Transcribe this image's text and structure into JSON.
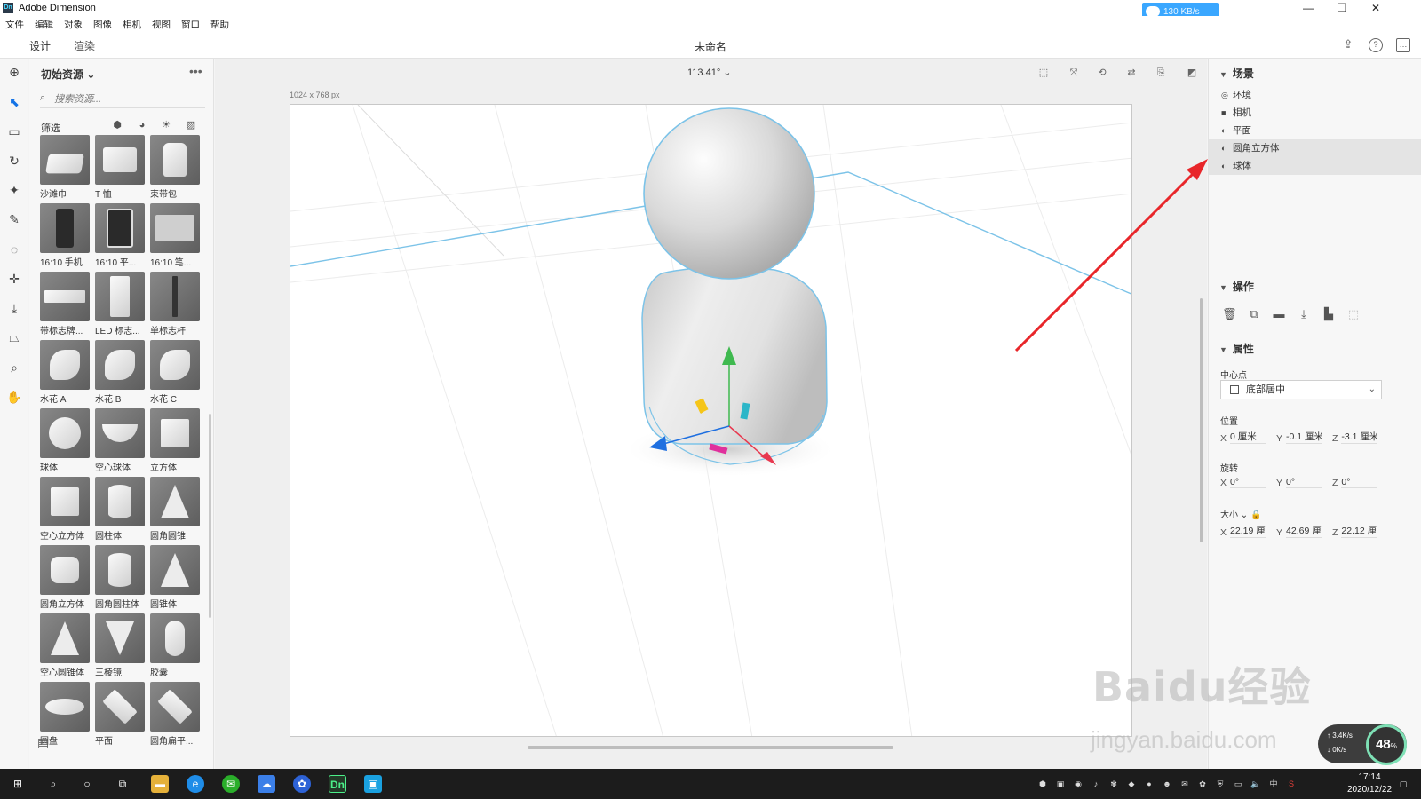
{
  "window": {
    "title": "Adobe Dimension",
    "logo_text": "Dn",
    "net_speed": "130 KB/s",
    "controls": [
      "—",
      "❐",
      "✕"
    ]
  },
  "menu": [
    "文件",
    "编辑",
    "对象",
    "图像",
    "相机",
    "视图",
    "窗口",
    "帮助"
  ],
  "header": {
    "tabs": [
      "设计",
      "渲染"
    ],
    "doc_title": "未命名"
  },
  "assets": {
    "title": "初始资源",
    "title_chevron": "⌄",
    "more": "•••",
    "search_placeholder": "搜索资源...",
    "filter_label": "筛选",
    "items": [
      {
        "label": "沙滩巾",
        "shape": "cloth"
      },
      {
        "label": "T 恤",
        "shape": "shirt"
      },
      {
        "label": "束带包",
        "shape": "bag"
      },
      {
        "label": "16:10 手机",
        "shape": "phone"
      },
      {
        "label": "16:10 平...",
        "shape": "tablet"
      },
      {
        "label": "16:10 笔...",
        "shape": "laptop"
      },
      {
        "label": "带标志牌...",
        "shape": "bench"
      },
      {
        "label": "LED 标志...",
        "shape": "sign"
      },
      {
        "label": "单标志杆",
        "shape": "pole"
      },
      {
        "label": "水花 A",
        "shape": "splash"
      },
      {
        "label": "水花 B",
        "shape": "splash"
      },
      {
        "label": "水花 C",
        "shape": "splash"
      },
      {
        "label": "球体",
        "shape": "sphere"
      },
      {
        "label": "空心球体",
        "shape": "bowl"
      },
      {
        "label": "立方体",
        "shape": "cube"
      },
      {
        "label": "空心立方体",
        "shape": "cube"
      },
      {
        "label": "圆柱体",
        "shape": "cylinder"
      },
      {
        "label": "圆角圆锥",
        "shape": "cone"
      },
      {
        "label": "圆角立方体",
        "shape": "roundcube"
      },
      {
        "label": "圆角圆柱体",
        "shape": "cylinder"
      },
      {
        "label": "圆锥体",
        "shape": "cone"
      },
      {
        "label": "空心圆锥体",
        "shape": "cone"
      },
      {
        "label": "三棱镜",
        "shape": "prism"
      },
      {
        "label": "胶囊",
        "shape": "capsule"
      },
      {
        "label": "圆盘",
        "shape": "disc"
      },
      {
        "label": "平面",
        "shape": "plane"
      },
      {
        "label": "圆角扁平...",
        "shape": "plane"
      }
    ]
  },
  "canvas": {
    "zoom": "113.41°",
    "size_label": "1024 x 768 px"
  },
  "scene": {
    "title": "场景",
    "items": [
      {
        "label": "环境",
        "icon": "◎",
        "selected": false
      },
      {
        "label": "相机",
        "icon": "■",
        "selected": false
      },
      {
        "label": "平面",
        "icon": "◐",
        "selected": false
      },
      {
        "label": "圆角立方体",
        "icon": "◐",
        "selected": true
      },
      {
        "label": "球体",
        "icon": "◐",
        "selected": true
      }
    ]
  },
  "actions": {
    "title": "操作"
  },
  "properties": {
    "title": "属性",
    "pivot_label": "中心点",
    "pivot_value": "底部居中",
    "position_label": "位置",
    "position": {
      "x": "0 厘米",
      "y": "-0.1 厘米",
      "z": "-3.1 厘米"
    },
    "rotation_label": "旋转",
    "rotation": {
      "x": "0°",
      "y": "0°",
      "z": "0°"
    },
    "size_label": "大小",
    "size": {
      "x": "22.19 厘",
      "y": "42.69 厘",
      "z": "22.12 厘"
    }
  },
  "taskbar": {
    "time": "17:14",
    "date": "2020/12/22",
    "ime": "中"
  },
  "perf": {
    "percent": "48",
    "unit": "%",
    "up": "3.4K/s",
    "down": "0K/s"
  },
  "watermark": {
    "brand": "Baidu经验",
    "url": "jingyan.baidu.com"
  },
  "colors": {
    "accent": "#1473e6",
    "selection_outline": "#7cc3e8",
    "annotation_arrow": "#e8262a",
    "gizmo_x": "#e8384f",
    "gizmo_y": "#3fb94f",
    "gizmo_z": "#1e6fe0"
  }
}
